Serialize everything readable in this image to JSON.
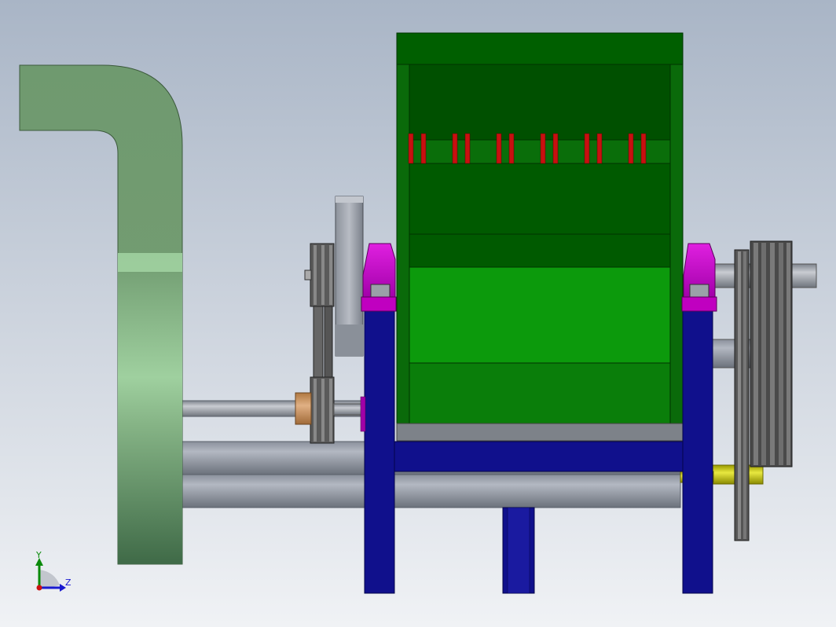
{
  "triad": {
    "y_label": "Y",
    "z_label": "Z",
    "y_color": "#0a8a0a",
    "z_color": "#1a1ad0",
    "x_color": "#cc1111"
  },
  "colors": {
    "bg_top": "#aab6c7",
    "bg_bottom": "#eef1f4",
    "hood_green": "#7fae7f",
    "hopper_dark": "#005500",
    "hopper_mid": "#0a6e0a",
    "hopper_bright": "#0a9a0a",
    "frame_blue": "#10108c",
    "bearing_magenta": "#c000c0",
    "blade_red": "#c81010",
    "shaft_grey": "#9aa0a8",
    "pulley_dark": "#3c3c3c",
    "coupling_tan": "#c89060",
    "yellow_shaft": "#c8c800"
  }
}
